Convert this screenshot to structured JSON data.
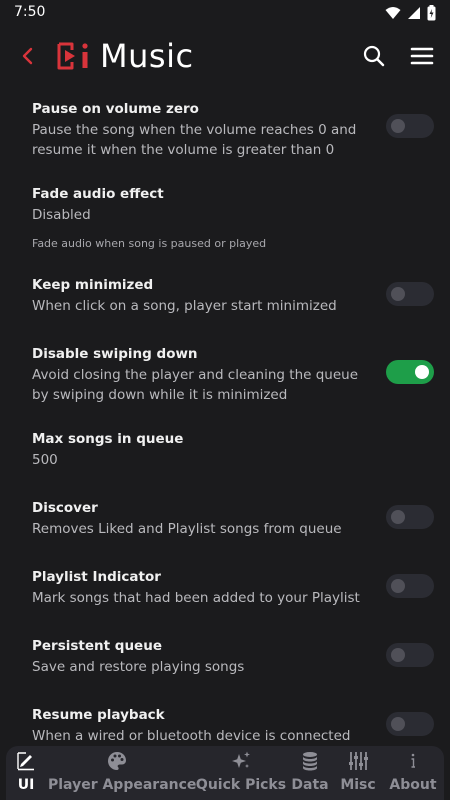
{
  "status_bar": {
    "time": "7:50"
  },
  "app_bar": {
    "title": "Music"
  },
  "colors": {
    "accent": "#d9343b",
    "toggle_on": "#1e9e49",
    "background": "#1b1b1d"
  },
  "settings": [
    {
      "title": "Pause on volume zero",
      "line1": "Pause the song when the volume reaches 0 and",
      "line2": "resume it when the volume is greater than 0",
      "toggle": false
    },
    {
      "title": "Fade audio effect",
      "value": "Disabled",
      "note": "Fade audio when song is paused or played"
    },
    {
      "title": "Keep minimized",
      "line1": "When click on a song, player start minimized",
      "toggle": false
    },
    {
      "title": "Disable swiping down",
      "line1": "Avoid closing the player and cleaning the queue",
      "line2": "by swiping down while it is minimized",
      "toggle": true
    },
    {
      "title": "Max songs in queue",
      "value": "500"
    },
    {
      "title": "Discover",
      "line1": "Removes Liked and Playlist songs from queue",
      "toggle": false
    },
    {
      "title": "Playlist Indicator",
      "line1": "Mark songs that had been added to your Playlist",
      "toggle": false
    },
    {
      "title": "Persistent queue",
      "line1": "Save and restore playing songs",
      "toggle": false
    },
    {
      "title": "Resume playback",
      "line1": "When a wired or bluetooth device is connected",
      "toggle": false
    }
  ],
  "bottom_nav": {
    "active": "UI",
    "items": [
      {
        "label": "UI",
        "icon": "edit-icon"
      },
      {
        "label": "Player Appearance",
        "icon": "palette-icon"
      },
      {
        "label": "Quick Picks",
        "icon": "sparkle-icon"
      },
      {
        "label": "Data",
        "icon": "database-icon"
      },
      {
        "label": "Misc",
        "icon": "sliders-icon"
      },
      {
        "label": "About",
        "icon": "info-icon"
      }
    ]
  }
}
